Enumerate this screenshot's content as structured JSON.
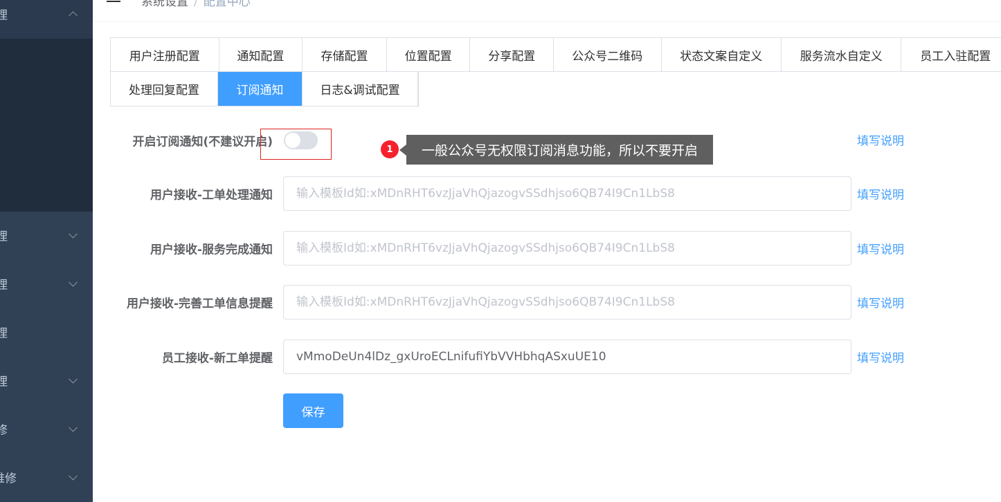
{
  "sidebar": {
    "items": [
      {
        "label": "理",
        "expanded": true
      },
      {
        "label": "理",
        "expanded": false
      },
      {
        "label": "理",
        "expanded": false
      },
      {
        "label": "理",
        "expanded": false
      },
      {
        "label": "理",
        "expanded": false
      },
      {
        "label": "修",
        "expanded": false
      },
      {
        "label": "维修",
        "expanded": false
      }
    ]
  },
  "header": {
    "breadcrumb": [
      "系统设置",
      "配置中心"
    ]
  },
  "tabs": {
    "row1": [
      "用户注册配置",
      "通知配置",
      "存储配置",
      "位置配置",
      "分享配置",
      "公众号二维码",
      "状态文案自定义",
      "服务流水自定义",
      "员工入驻配置"
    ],
    "row2": [
      "处理回复配置",
      "订阅通知",
      "日志&调试配置"
    ],
    "active": "订阅通知"
  },
  "form": {
    "switch_label": "开启订阅通知(不建议开启)",
    "switch_on": false,
    "help_text": "填写说明",
    "tooltip_badge": "1",
    "tooltip_text": "一般公众号无权限订阅消息功能，所以不要开启",
    "fields": [
      {
        "label": "用户接收-工单处理通知",
        "value": "",
        "placeholder": "输入模板Id如:xMDnRHT6vzJjaVhQjazogvSSdhjso6QB74I9Cn1LbS8"
      },
      {
        "label": "用户接收-服务完成通知",
        "value": "",
        "placeholder": "输入模板Id如:xMDnRHT6vzJjaVhQjazogvSSdhjso6QB74I9Cn1LbS8"
      },
      {
        "label": "用户接收-完善工单信息提醒",
        "value": "",
        "placeholder": "输入模板Id如:xMDnRHT6vzJjaVhQjazogvSSdhjso6QB74I9Cn1LbS8"
      },
      {
        "label": "员工接收-新工单提醒",
        "value": "vMmoDeUn4lDz_gxUroECLnifufiYbVVHbhqASxuUE10",
        "placeholder": ""
      }
    ],
    "save_label": "保存"
  },
  "colors": {
    "sidebar_bg": "#304156",
    "primary": "#409eff",
    "badge_red": "#f5222d",
    "tooltip_bg": "#5f5f5f"
  }
}
